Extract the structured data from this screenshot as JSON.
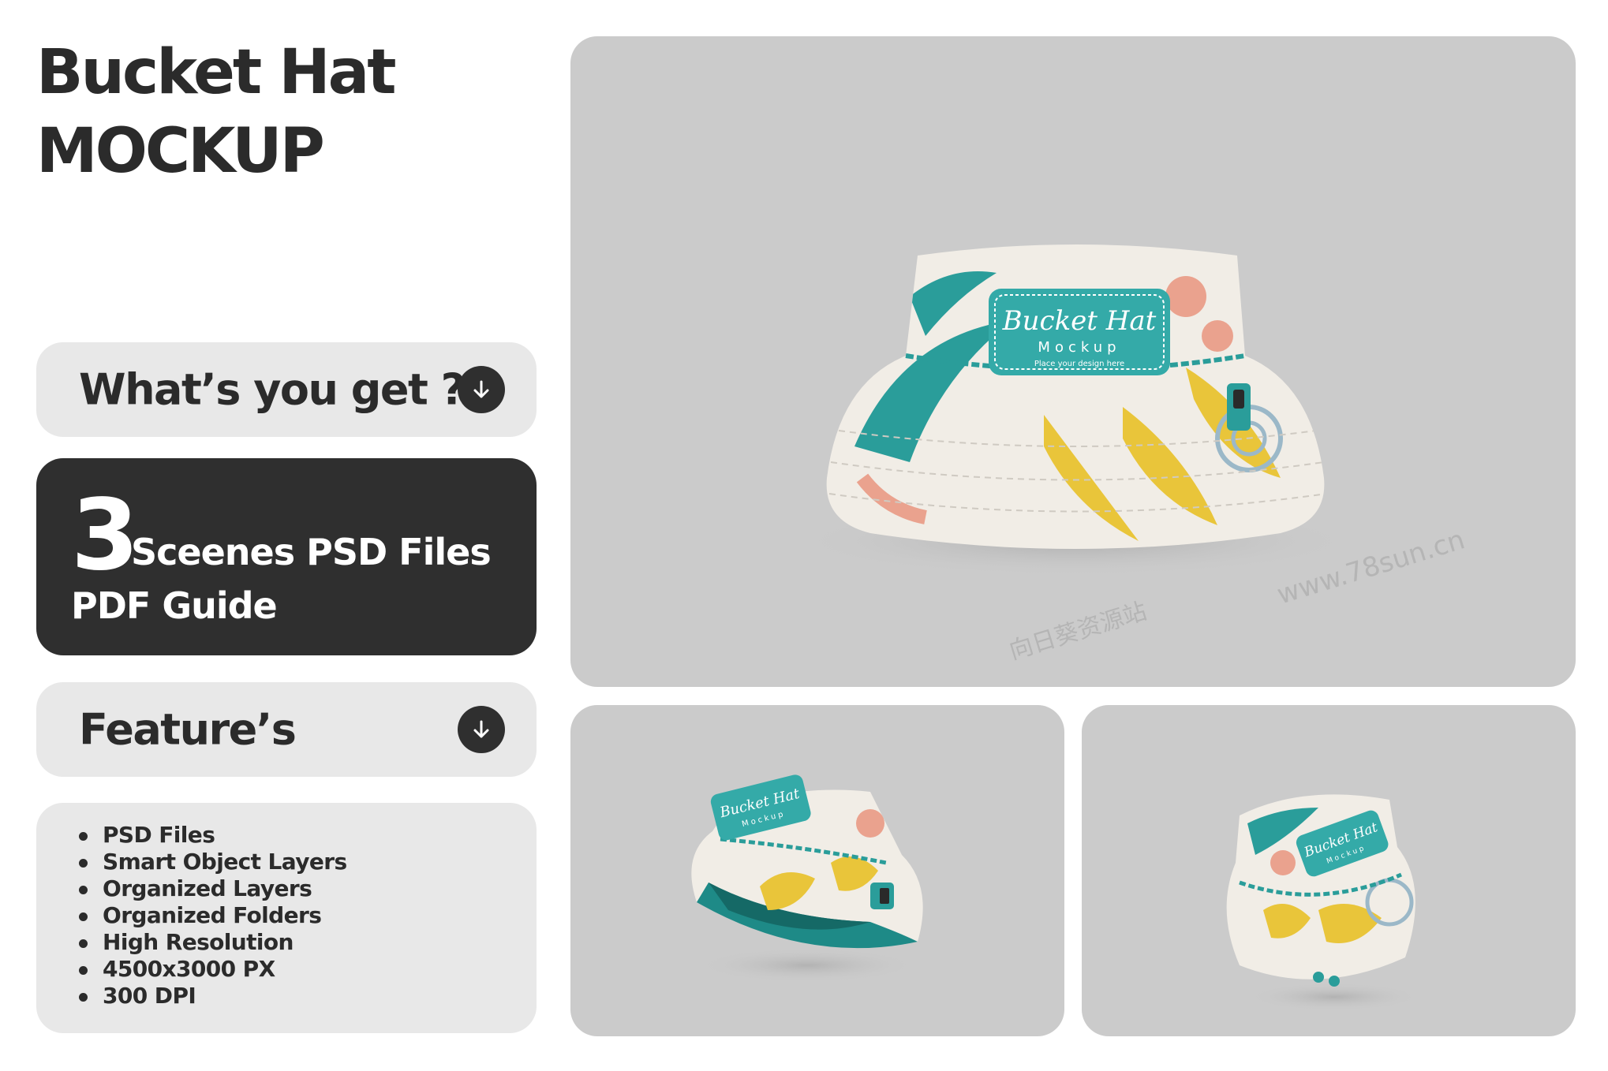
{
  "title": {
    "line1": "Bucket Hat",
    "line2": "MOCKUP"
  },
  "get_section": {
    "label": "What’s you get ?"
  },
  "scenes_card": {
    "number": "3",
    "line1": "Sceenes PSD Files",
    "line2": "PDF Guide"
  },
  "features_section": {
    "label": "Feature’s"
  },
  "features": [
    "PSD Files",
    "Smart Object Layers",
    "Organized Layers",
    "Organized Folders",
    "High Resolution",
    "4500x3000 PX",
    "300 DPI"
  ],
  "hat_patch": {
    "script": "Bucket Hat",
    "sub": "Mockup",
    "note": "Place your design here"
  },
  "watermarks": [
    "www.78sun.cn",
    "向日葵资源站"
  ],
  "colors": {
    "dark_panel": "#2f2f2f",
    "light_panel": "#e8e8e8",
    "scene_bg": "#cbcbcb",
    "teal_accent": "#2a9d9a",
    "yellow_accent": "#e9c53a",
    "salmon_accent": "#eaa28e"
  },
  "icons": {
    "arrow": "arrow-down-icon",
    "watermark_logo": "sunflower-logo-icon"
  }
}
